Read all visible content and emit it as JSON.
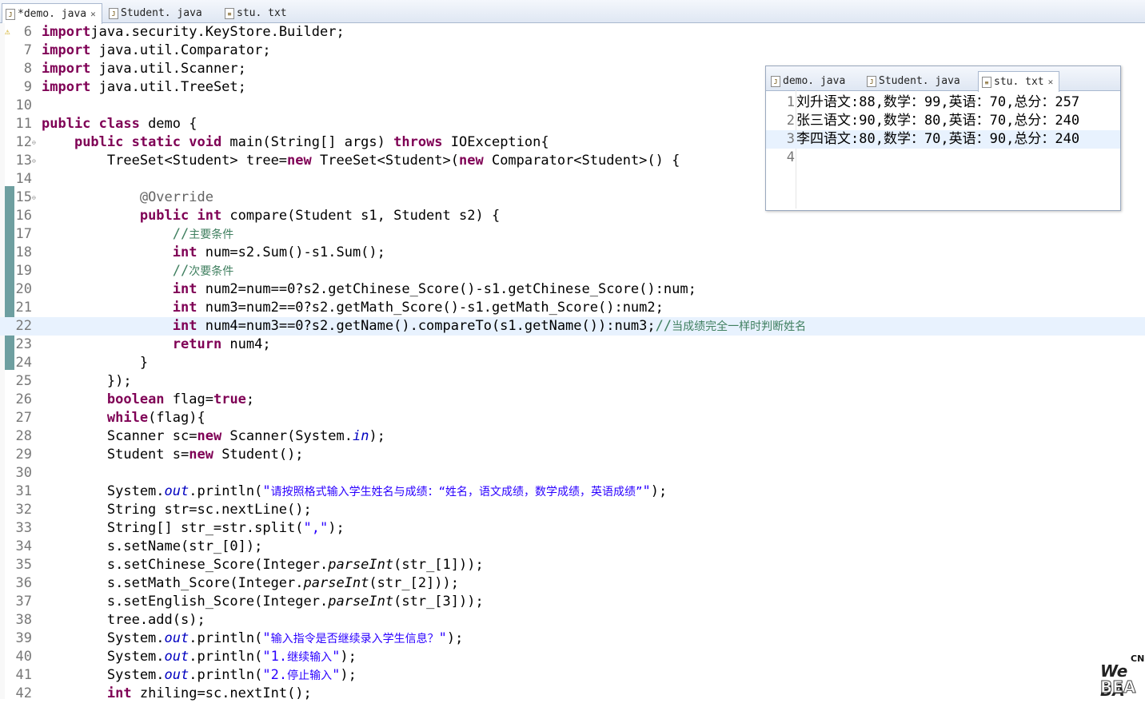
{
  "editor_tabs": [
    {
      "label": "*demo. java",
      "active": true,
      "closable": true
    },
    {
      "label": "Student. java",
      "active": false,
      "closable": false
    },
    {
      "label": "stu. txt",
      "active": false,
      "closable": false
    }
  ],
  "code_lines": [
    {
      "n": "6",
      "segs": [
        [
          "kw",
          "import"
        ],
        [
          "",
          "java.security.KeyStore.Builder;"
        ]
      ]
    },
    {
      "n": "7",
      "segs": [
        [
          "kw",
          "import"
        ],
        [
          "",
          " java.util.Comparator;"
        ]
      ]
    },
    {
      "n": "8",
      "segs": [
        [
          "kw",
          "import"
        ],
        [
          "",
          " java.util.Scanner;"
        ]
      ]
    },
    {
      "n": "9",
      "segs": [
        [
          "kw",
          "import"
        ],
        [
          "",
          " java.util.TreeSet;"
        ]
      ]
    },
    {
      "n": "10",
      "segs": []
    },
    {
      "n": "11",
      "segs": [
        [
          "kw",
          "public class"
        ],
        [
          "",
          " demo {"
        ]
      ]
    },
    {
      "n": "12",
      "fold": true,
      "segs": [
        [
          "",
          "    "
        ],
        [
          "kw",
          "public static void"
        ],
        [
          "",
          " main(String[] args) "
        ],
        [
          "kw",
          "throws"
        ],
        [
          "",
          " IOException{"
        ]
      ]
    },
    {
      "n": "13",
      "fold": true,
      "segs": [
        [
          "",
          "        TreeSet<Student> tree="
        ],
        [
          "kw",
          "new"
        ],
        [
          "",
          " TreeSet<Student>("
        ],
        [
          "kw",
          "new"
        ],
        [
          "",
          " Comparator<Student>() {"
        ]
      ]
    },
    {
      "n": "14",
      "segs": []
    },
    {
      "n": "15",
      "fold": true,
      "segs": [
        [
          "",
          "            "
        ],
        [
          "ann",
          "@Override"
        ]
      ]
    },
    {
      "n": "16",
      "segs": [
        [
          "",
          "            "
        ],
        [
          "kw",
          "public int"
        ],
        [
          "",
          " compare(Student s1, Student s2) {"
        ]
      ]
    },
    {
      "n": "17",
      "segs": [
        [
          "",
          "                "
        ],
        [
          "cmt",
          "//"
        ],
        [
          "cmt cn",
          "主要条件"
        ]
      ]
    },
    {
      "n": "18",
      "segs": [
        [
          "",
          "                "
        ],
        [
          "kw",
          "int"
        ],
        [
          "",
          " num=s2.Sum()-s1.Sum();"
        ]
      ]
    },
    {
      "n": "19",
      "segs": [
        [
          "",
          "                "
        ],
        [
          "cmt",
          "//"
        ],
        [
          "cmt cn",
          "次要条件"
        ]
      ]
    },
    {
      "n": "20",
      "segs": [
        [
          "",
          "                "
        ],
        [
          "kw",
          "int"
        ],
        [
          "",
          " num2=num==0?s2.getChinese_Score()-s1.getChinese_Score():num;"
        ]
      ]
    },
    {
      "n": "21",
      "segs": [
        [
          "",
          "                "
        ],
        [
          "kw",
          "int"
        ],
        [
          "",
          " num3=num2==0?s2.getMath_Score()-s1.getMath_Score():num2;"
        ]
      ]
    },
    {
      "n": "22",
      "current": true,
      "segs": [
        [
          "",
          "                "
        ],
        [
          "kw",
          "int"
        ],
        [
          "",
          " num4=num3==0?s2.getName().compareTo(s1.getName()):num3;"
        ],
        [
          "cmt",
          "//"
        ],
        [
          "cmt cn",
          "当成绩完全一样时判断姓名"
        ]
      ]
    },
    {
      "n": "23",
      "segs": [
        [
          "",
          "                "
        ],
        [
          "kw",
          "return"
        ],
        [
          "",
          " num4;"
        ]
      ]
    },
    {
      "n": "24",
      "segs": [
        [
          "",
          "            }"
        ]
      ]
    },
    {
      "n": "25",
      "segs": [
        [
          "",
          "        });"
        ]
      ]
    },
    {
      "n": "26",
      "segs": [
        [
          "",
          "        "
        ],
        [
          "kw",
          "boolean"
        ],
        [
          "",
          " flag="
        ],
        [
          "kw",
          "true"
        ],
        [
          "",
          ";"
        ]
      ]
    },
    {
      "n": "27",
      "segs": [
        [
          "",
          "        "
        ],
        [
          "kw",
          "while"
        ],
        [
          "",
          "(flag){"
        ]
      ]
    },
    {
      "n": "28",
      "segs": [
        [
          "",
          "        Scanner sc="
        ],
        [
          "kw",
          "new"
        ],
        [
          "",
          " Scanner(System."
        ],
        [
          "fld",
          "in"
        ],
        [
          "",
          ");"
        ]
      ]
    },
    {
      "n": "29",
      "segs": [
        [
          "",
          "        Student s="
        ],
        [
          "kw",
          "new"
        ],
        [
          "",
          " Student();"
        ]
      ]
    },
    {
      "n": "30",
      "segs": []
    },
    {
      "n": "31",
      "segs": [
        [
          "",
          "        System."
        ],
        [
          "fld",
          "out"
        ],
        [
          "",
          ".println("
        ],
        [
          "str",
          "\""
        ],
        [
          "str cn",
          "请按照格式输入学生姓名与成绩：“姓名，语文成绩，数学成绩，英语成绩”"
        ],
        [
          "str",
          "\""
        ],
        [
          "",
          ");"
        ]
      ]
    },
    {
      "n": "32",
      "segs": [
        [
          "",
          "        String str=sc.nextLine();"
        ]
      ]
    },
    {
      "n": "33",
      "segs": [
        [
          "",
          "        String[] str_=str.split("
        ],
        [
          "str",
          "\",\""
        ],
        [
          "",
          ");"
        ]
      ]
    },
    {
      "n": "34",
      "segs": [
        [
          "",
          "        s.setName(str_[0]);"
        ]
      ]
    },
    {
      "n": "35",
      "segs": [
        [
          "",
          "        s.setChinese_Score(Integer."
        ],
        [
          "it",
          "parseInt"
        ],
        [
          "",
          "(str_[1]));"
        ]
      ]
    },
    {
      "n": "36",
      "segs": [
        [
          "",
          "        s.setMath_Score(Integer."
        ],
        [
          "it",
          "parseInt"
        ],
        [
          "",
          "(str_[2]));"
        ]
      ]
    },
    {
      "n": "37",
      "segs": [
        [
          "",
          "        s.setEnglish_Score(Integer."
        ],
        [
          "it",
          "parseInt"
        ],
        [
          "",
          "(str_[3]));"
        ]
      ]
    },
    {
      "n": "38",
      "segs": [
        [
          "",
          "        tree.add(s);"
        ]
      ]
    },
    {
      "n": "39",
      "segs": [
        [
          "",
          "        System."
        ],
        [
          "fld",
          "out"
        ],
        [
          "",
          ".println("
        ],
        [
          "str",
          "\""
        ],
        [
          "str cn",
          "输入指令是否继续录入学生信息？"
        ],
        [
          "str",
          "\""
        ],
        [
          "",
          ");"
        ]
      ]
    },
    {
      "n": "40",
      "segs": [
        [
          "",
          "        System."
        ],
        [
          "fld",
          "out"
        ],
        [
          "",
          ".println("
        ],
        [
          "str",
          "\"1."
        ],
        [
          "str cn",
          "继续输入"
        ],
        [
          "str",
          "\""
        ],
        [
          "",
          ");"
        ]
      ]
    },
    {
      "n": "41",
      "segs": [
        [
          "",
          "        System."
        ],
        [
          "fld",
          "out"
        ],
        [
          "",
          ".println("
        ],
        [
          "str",
          "\"2."
        ],
        [
          "str cn",
          "停止输入"
        ],
        [
          "str",
          "\""
        ],
        [
          "",
          ");"
        ]
      ]
    },
    {
      "n": "42",
      "segs": [
        [
          "",
          "        "
        ],
        [
          "kw",
          "int"
        ],
        [
          "",
          " zhiling=sc.nextInt();"
        ]
      ]
    }
  ],
  "popup": {
    "tabs": [
      {
        "label": "demo. java",
        "active": false
      },
      {
        "label": "Student. java",
        "active": false
      },
      {
        "label": "stu. txt",
        "active": true
      }
    ],
    "lines": [
      {
        "n": "1",
        "text": "刘升语文:88,数学：99,英语：70,总分：257"
      },
      {
        "n": "2",
        "text": "张三语文:90,数学：80,英语：70,总分：240"
      },
      {
        "n": "3",
        "text": "李四语文:80,数学：70,英语：90,总分：240",
        "current": true
      },
      {
        "n": "4",
        "text": ""
      }
    ]
  },
  "watermark": {
    "line1": "CN",
    "line2": "We BA",
    "line3": "BEA"
  },
  "colors": {
    "keyword": "#7f0055",
    "string": "#2a00ff",
    "comment": "#3f7f5f",
    "annotation": "#646464",
    "field": "#0000c0",
    "current_line": "#e8f2fe"
  }
}
